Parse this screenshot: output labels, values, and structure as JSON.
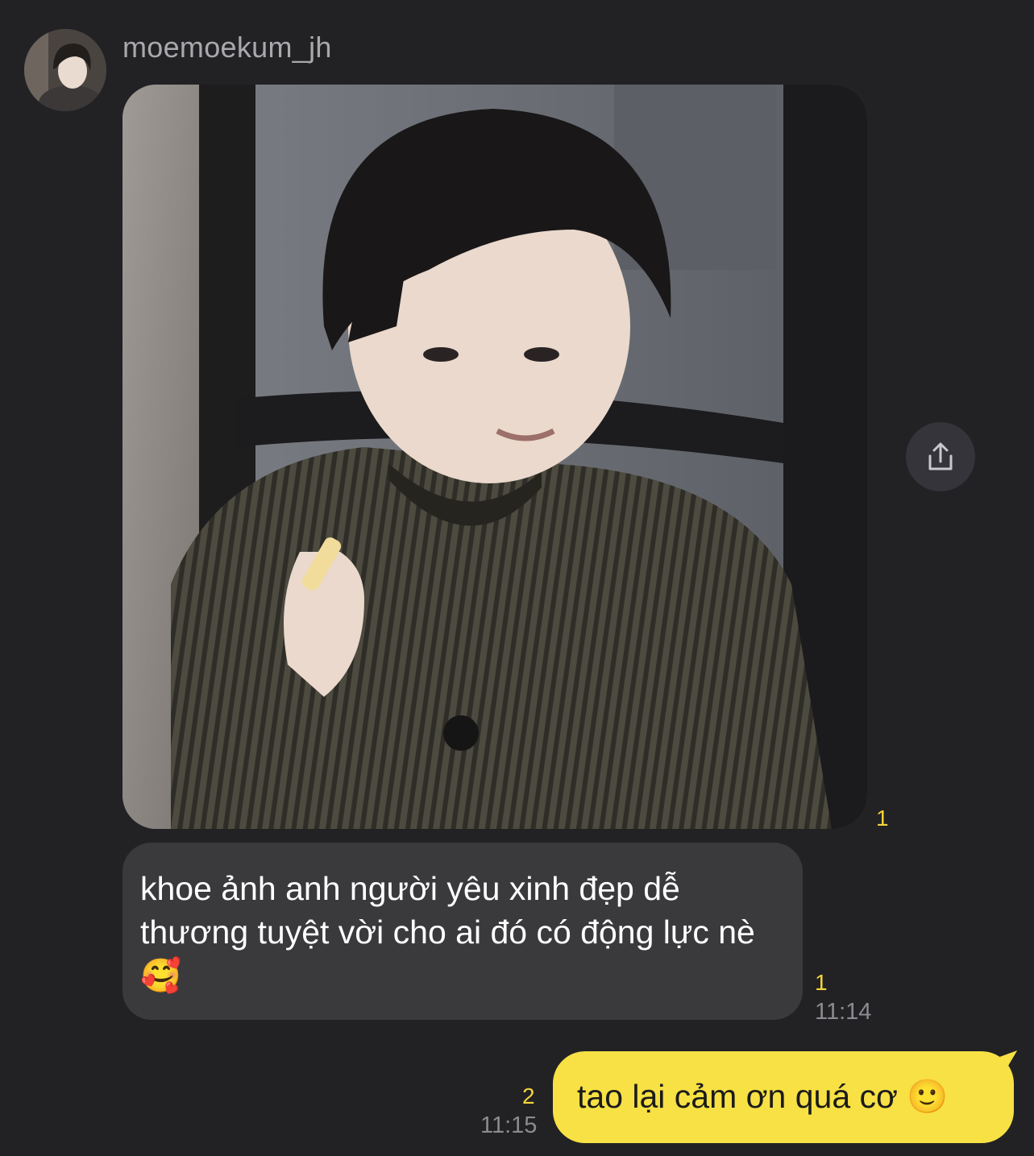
{
  "sender": {
    "username": "moemoekum_jh",
    "avatar_icon": "profile-photo"
  },
  "messages": {
    "photo": {
      "unread_count": "1",
      "share_icon": "share-icon"
    },
    "text": {
      "body": "khoe ảnh anh người yêu xinh đẹp dễ thương tuyệt vời cho ai đó có động lực nè 🥰",
      "unread_count": "1",
      "time": "11:14"
    },
    "reply": {
      "body": "tao lại cảm ơn quá cơ 🙂",
      "unread_count": "2",
      "time": "11:15"
    }
  },
  "colors": {
    "background": "#222225",
    "incoming_bubble": "#3a3a3d",
    "outgoing_bubble": "#f7e144",
    "unread": "#f4d43c"
  }
}
